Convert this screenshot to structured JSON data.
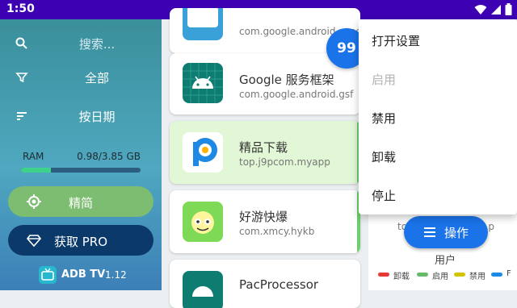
{
  "status_bar": {
    "time": "1:50",
    "icons": [
      "wifi-icon",
      "signal-icon",
      "battery-icon"
    ]
  },
  "sidebar": {
    "search": {
      "label": "搜索...",
      "icon": "search-icon"
    },
    "filter": {
      "label": "全部",
      "icon": "filter-icon"
    },
    "sort": {
      "label": "按日期",
      "icon": "sort-icon"
    },
    "ram": {
      "label": "RAM",
      "value": "0.98/3.85 GB",
      "used_fraction": 0.25
    },
    "simple_button": {
      "label": "精简",
      "icon": "target-icon"
    },
    "pro_button": {
      "label": "获取 PRO",
      "icon": "diamond-icon"
    },
    "brand": {
      "name": "ADB TV",
      "version": "1.12",
      "icon": "tv-icon"
    }
  },
  "app_list": [
    {
      "name": "",
      "package": "com.google.android.syncadapters"
    },
    {
      "name": "Google 服务框架",
      "package": "com.google.android.gsf"
    },
    {
      "name": "精品下载",
      "package": "top.j9pcom.myapp",
      "selected": true
    },
    {
      "name": "好游快爆",
      "package": "com.xmcy.hykb"
    },
    {
      "name": "PacProcessor",
      "package": ""
    }
  ],
  "badge": {
    "count": "99"
  },
  "context_menu": {
    "items": [
      {
        "label": "打开设置",
        "enabled": true
      },
      {
        "label": "启用",
        "enabled": false
      },
      {
        "label": "禁用",
        "enabled": true
      },
      {
        "label": "卸载",
        "enabled": true
      },
      {
        "label": "停止",
        "enabled": true
      }
    ]
  },
  "detail_panel": {
    "package_prefix": "to",
    "package_suffix": "p",
    "user_label": "用户",
    "operate_button": {
      "label": "操作",
      "icon": "menu-icon"
    }
  },
  "legend": [
    {
      "label": "卸载",
      "color": "#e53935"
    },
    {
      "label": "启用",
      "color": "#66bb6a"
    },
    {
      "label": "禁用",
      "color": "#d4c400"
    },
    {
      "label": "F",
      "color": "#1e88e5"
    }
  ],
  "colors": {
    "accent": "#1a73e8",
    "status_bar": "#3d00b3",
    "selected_card": "#e2f7d6"
  }
}
